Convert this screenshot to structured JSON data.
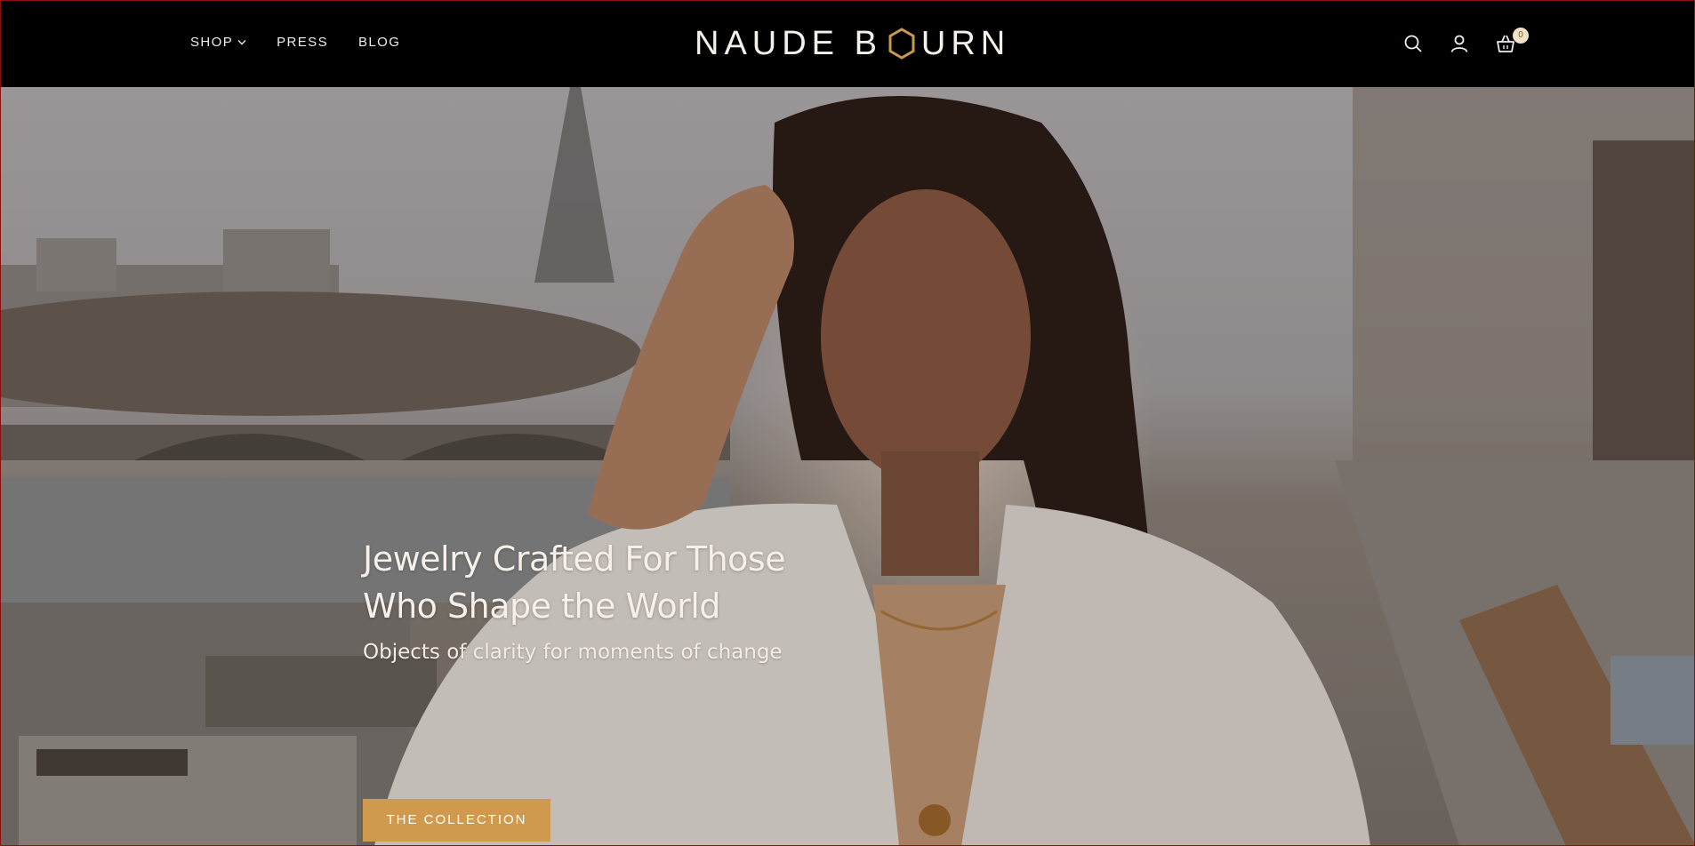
{
  "header": {
    "nav": [
      {
        "label": "SHOP",
        "has_dropdown": true
      },
      {
        "label": "PRESS"
      },
      {
        "label": "BLOG"
      }
    ],
    "logo": {
      "left": "NAUDE B",
      "right": "URN",
      "mark_color": "#c89a4a"
    },
    "icons": [
      "search-icon",
      "account-icon",
      "cart-icon"
    ],
    "cart_count": "0"
  },
  "hero": {
    "title": "Jewelry Crafted For Those Who Shape the World",
    "subtitle": "Objects of clarity for moments of change",
    "cta_label": "THE COLLECTION",
    "cta_color": "#d09a4e"
  }
}
